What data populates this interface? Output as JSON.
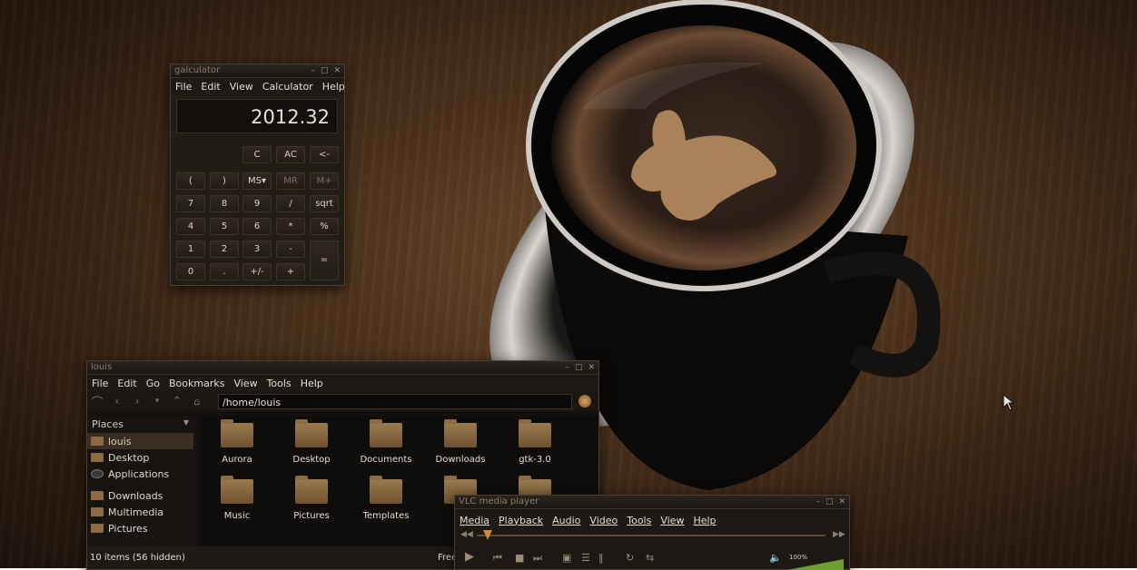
{
  "calculator": {
    "title": "galculator",
    "menu": [
      "File",
      "Edit",
      "View",
      "Calculator",
      "Help"
    ],
    "display": "2012.32",
    "buttons": {
      "c": "C",
      "ac": "AC",
      "back": "<-",
      "lparen": "(",
      "rparen": ")",
      "ms": "MS▾",
      "mr": "MR",
      "mplus": "M+",
      "n7": "7",
      "n8": "8",
      "n9": "9",
      "div": "/",
      "sqrt": "sqrt",
      "n4": "4",
      "n5": "5",
      "n6": "6",
      "mul": "*",
      "pct": "%",
      "n1": "1",
      "n2": "2",
      "n3": "3",
      "sub": "-",
      "eq": "=",
      "n0": "0",
      "dot": ".",
      "sign": "+/-",
      "add": "+"
    }
  },
  "file_manager": {
    "title": "louis",
    "menu": [
      "File",
      "Edit",
      "Go",
      "Bookmarks",
      "View",
      "Tools",
      "Help"
    ],
    "path": "/home/louis",
    "places_header": "Places",
    "places": [
      "louis",
      "Desktop",
      "Applications"
    ],
    "places2": [
      "Downloads",
      "Multimedia",
      "Pictures"
    ],
    "folders": [
      "Aurora",
      "Desktop",
      "Documents",
      "Downloads",
      "gtk-3.0",
      "Music",
      "Pictures",
      "Templates",
      "",
      ""
    ],
    "status": "10 items (56 hidden)",
    "free_space": "Free"
  },
  "vlc": {
    "title": "VLC media player",
    "menu": [
      "Media",
      "Playback",
      "Audio",
      "Video",
      "Tools",
      "View",
      "Help"
    ],
    "volume": "100%",
    "position": 0.03
  },
  "colors": {
    "accent": "#c88a3e",
    "folder": "#8a6b43",
    "window_bg": "#171310"
  }
}
